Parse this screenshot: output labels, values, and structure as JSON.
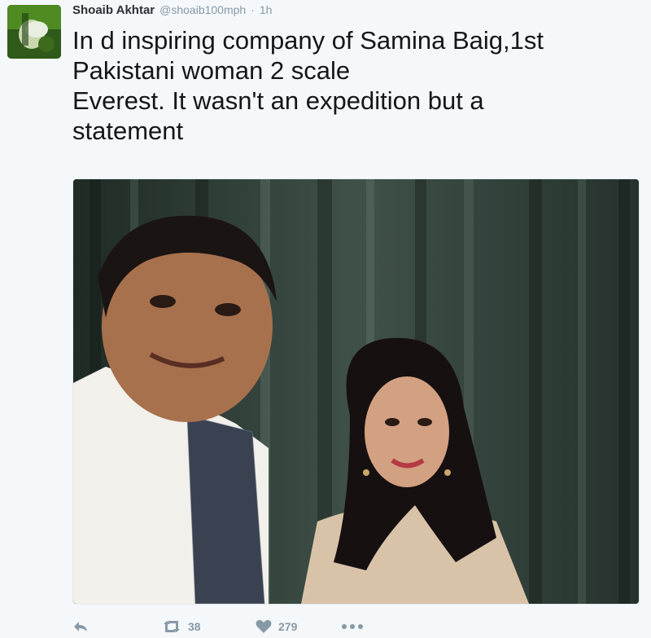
{
  "tweet": {
    "author_name": "Shoaib Akhtar",
    "handle": "@shoaib100mph",
    "separator": "·",
    "time": "1h",
    "text": "In d inspiring company of Samina Baig,1st\nPakistani woman 2 scale\n Everest. It wasn't an expedition but a\nstatement"
  },
  "actions": {
    "reply_icon": "reply-icon",
    "retweet_icon": "retweet-icon",
    "retweet_count": "38",
    "like_icon": "heart-icon",
    "like_count": "279",
    "more_icon": "more-icon"
  },
  "colors": {
    "background": "#f5f8fa",
    "muted": "#8899a6",
    "text": "#14171a"
  }
}
